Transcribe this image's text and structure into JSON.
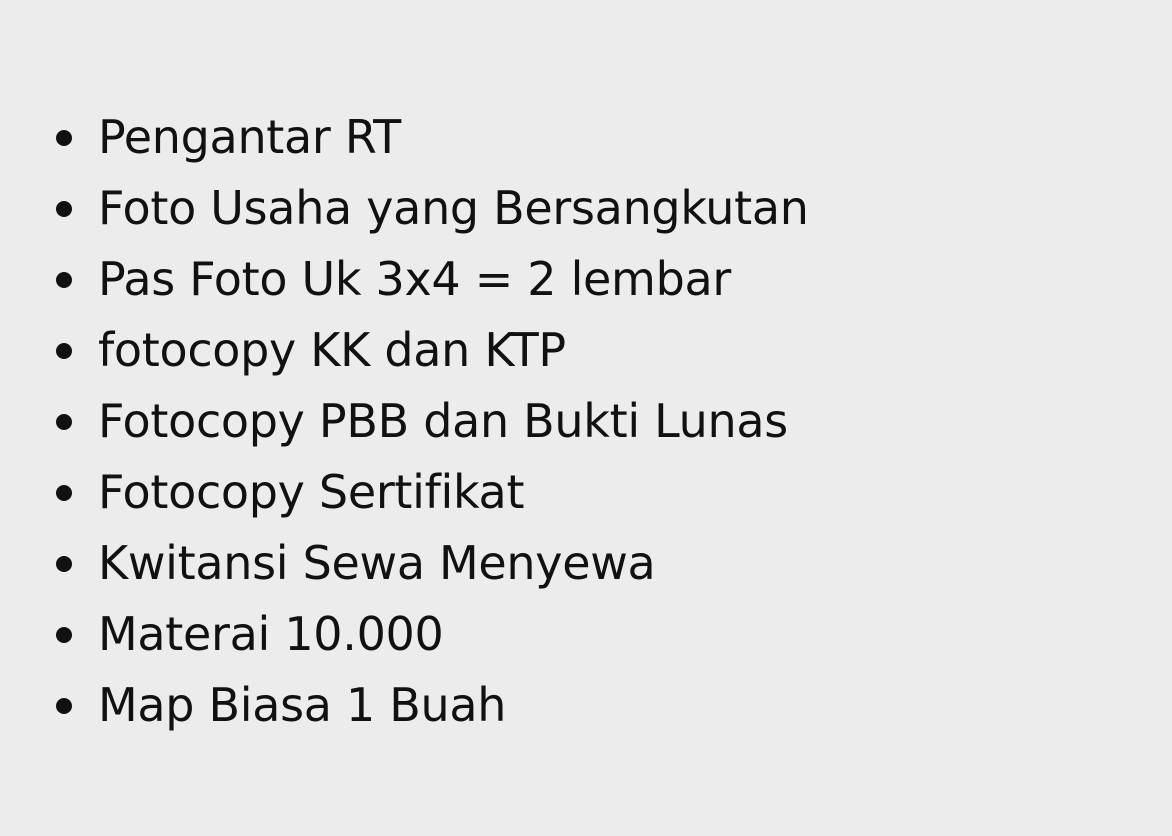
{
  "requirements": {
    "items": [
      "Pengantar RT",
      "Foto Usaha yang Bersangkutan",
      "Pas Foto Uk 3x4 = 2 lembar",
      "fotocopy KK dan KTP",
      "Fotocopy PBB dan Bukti Lunas",
      "Fotocopy Sertifikat",
      "Kwitansi Sewa Menyewa",
      "Materai 10.000",
      "Map Biasa 1 Buah"
    ]
  },
  "colors": {
    "background": "#ececec",
    "text": "#111111"
  }
}
